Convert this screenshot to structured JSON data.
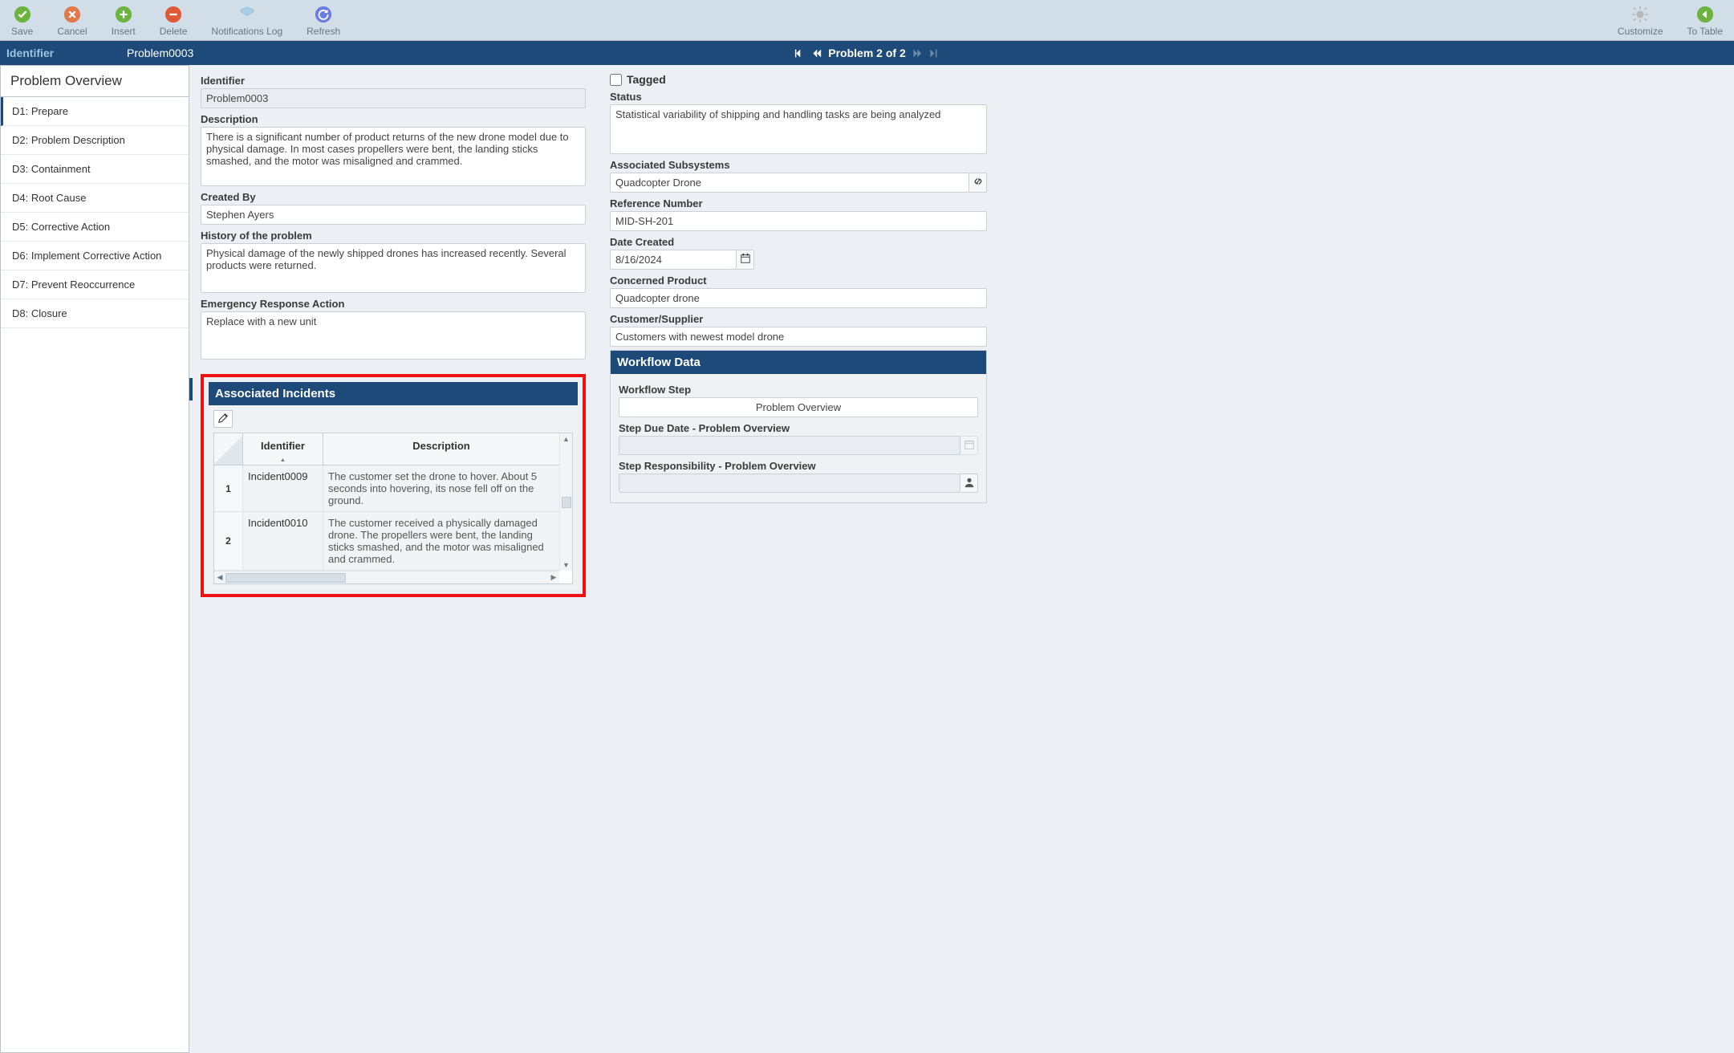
{
  "toolbar": {
    "save": "Save",
    "cancel": "Cancel",
    "insert": "Insert",
    "delete": "Delete",
    "notifications": "Notifications Log",
    "refresh": "Refresh",
    "customize": "Customize",
    "totable": "To Table"
  },
  "header": {
    "title": "Identifier",
    "identifier": "Problem0003",
    "pager": "Problem 2 of 2"
  },
  "sidebar": {
    "header": "Problem Overview",
    "items": [
      "D1: Prepare",
      "D2: Problem Description",
      "D3: Containment",
      "D4: Root Cause",
      "D5: Corrective Action",
      "D6: Implement Corrective Action",
      "D7: Prevent Reoccurrence",
      "D8: Closure"
    ]
  },
  "left": {
    "identifier_label": "Identifier",
    "identifier_value": "Problem0003",
    "description_label": "Description",
    "description_value": "There is a significant number of product returns of the new drone model due to physical damage. In most cases propellers were bent, the landing sticks smashed, and the motor was misaligned and crammed.",
    "createdby_label": "Created By",
    "createdby_value": "Stephen Ayers",
    "history_label": "History of the problem",
    "history_value": "Physical damage of the newly shipped drones has increased recently. Several products were returned.",
    "emergency_label": "Emergency Response Action",
    "emergency_value": "Replace with a new unit"
  },
  "right": {
    "tagged_label": "Tagged",
    "status_label": "Status",
    "status_value": "Statistical variability of shipping and handling tasks are being analyzed",
    "assoc_sub_label": "Associated Subsystems",
    "assoc_sub_value": "Quadcopter Drone",
    "refnum_label": "Reference Number",
    "refnum_value": "MID-SH-201",
    "datecreated_label": "Date Created",
    "datecreated_value": "8/16/2024",
    "concerned_label": "Concerned Product",
    "concerned_value": "Quadcopter drone",
    "custsup_label": "Customer/Supplier",
    "custsup_value": "Customers with newest model drone"
  },
  "workflow": {
    "header": "Workflow Data",
    "step_label": "Workflow Step",
    "step_value": "Problem Overview",
    "due_label": "Step Due Date - Problem Overview",
    "resp_label": "Step Responsibility - Problem Overview"
  },
  "incidents": {
    "header": "Associated Incidents",
    "col_identifier": "Identifier",
    "col_description": "Description",
    "rows": [
      {
        "n": "1",
        "id": "Incident0009",
        "desc": "The customer set the drone to hover. About 5 seconds into hovering, its nose fell off on the ground."
      },
      {
        "n": "2",
        "id": "Incident0010",
        "desc": "The customer received a physically damaged drone. The propellers were bent, the landing sticks smashed, and the motor was misaligned and crammed."
      }
    ]
  }
}
